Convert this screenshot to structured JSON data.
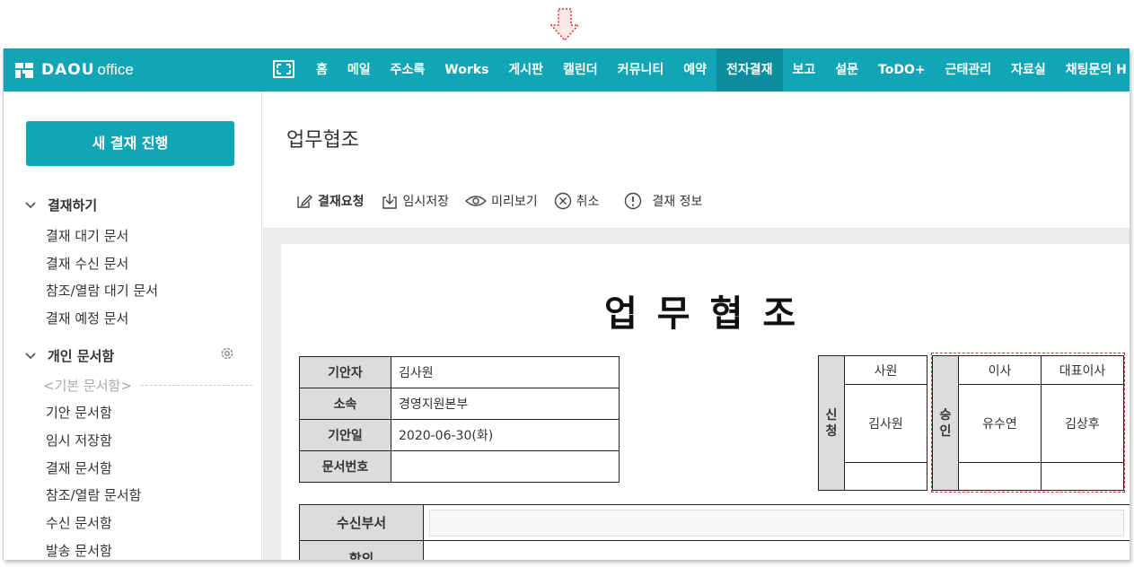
{
  "arrow": {
    "icon": "down-arrow-icon",
    "color": "#e03030"
  },
  "brand": {
    "daou": "DAOU",
    "office": "office",
    "color": "#12a5b6"
  },
  "nav": {
    "items": [
      {
        "label": "홈"
      },
      {
        "label": "메일"
      },
      {
        "label": "주소록"
      },
      {
        "label": "Works"
      },
      {
        "label": "게시판"
      },
      {
        "label": "캘린더"
      },
      {
        "label": "커뮤니티"
      },
      {
        "label": "예약"
      },
      {
        "label": "전자결재",
        "active": true
      },
      {
        "label": "보고"
      },
      {
        "label": "설문"
      },
      {
        "label": "ToDO+"
      },
      {
        "label": "근태관리"
      },
      {
        "label": "자료실"
      },
      {
        "label": "채팅문의 H"
      }
    ]
  },
  "sidebar": {
    "new_button": "새 결재 진행",
    "sections": [
      {
        "title": "결재하기",
        "items": [
          "결재 대기 문서",
          "결재 수신 문서",
          "참조/열람 대기 문서",
          "결재 예정 문서"
        ]
      },
      {
        "title": "개인 문서함",
        "subheader": "<기본 문서함>",
        "items": [
          "기안 문서함",
          "임시 저장함",
          "결재 문서함",
          "참조/열람 문서함",
          "수신 문서함",
          "발송 문서함"
        ]
      }
    ]
  },
  "main": {
    "title": "업무협조",
    "toolbar": {
      "request": "결재요청",
      "save": "임시저장",
      "preview": "미리보기",
      "cancel": "취소",
      "info": "결재 정보"
    }
  },
  "doc": {
    "title": "업무협조",
    "info": {
      "drafter_label": "기안자",
      "drafter": "김사원",
      "dept_label": "소속",
      "dept": "경영지원본부",
      "date_label": "기안일",
      "date": "2020-06-30(화)",
      "docno_label": "문서번호",
      "docno": ""
    },
    "apply": {
      "label": "신청",
      "position": "사원",
      "name": "김사원"
    },
    "approve": {
      "label": "승인",
      "positions": [
        "이사",
        "대표이사"
      ],
      "names": [
        "유수연",
        "김상후"
      ]
    },
    "receive_label": "수신부서",
    "next_label": "합의"
  }
}
